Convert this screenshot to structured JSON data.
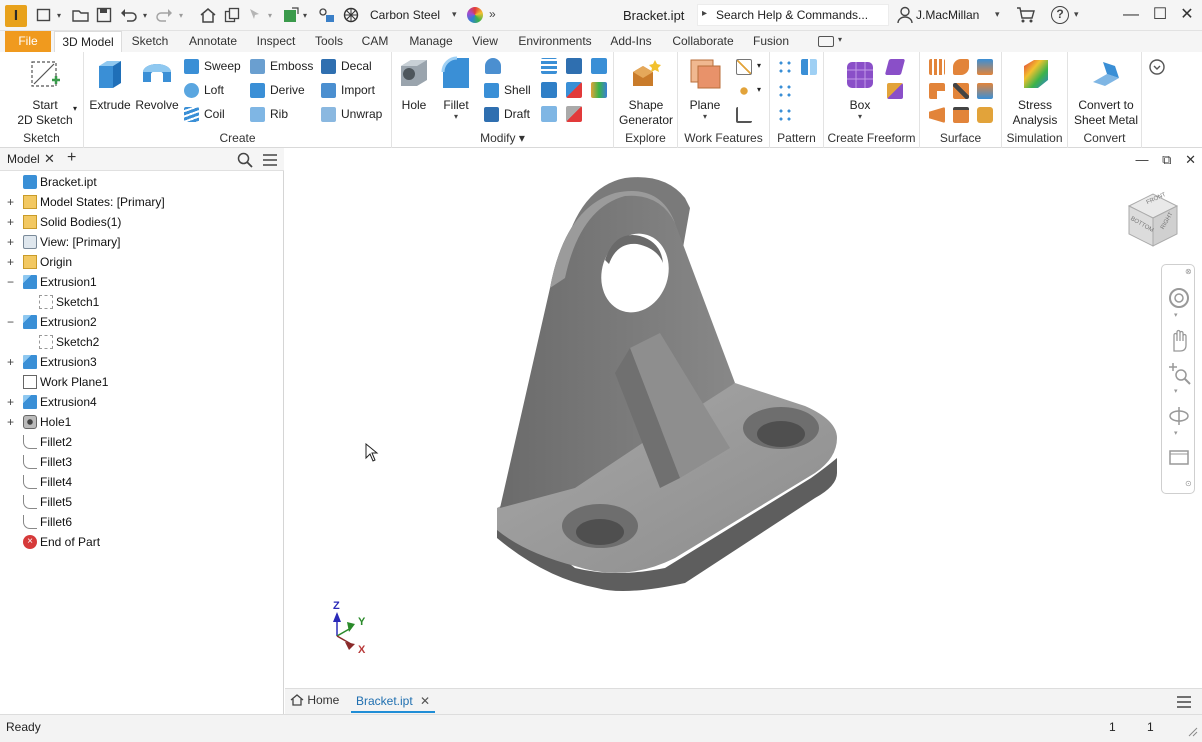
{
  "app": {
    "logo_letter": "I"
  },
  "titlebar": {
    "material": "Carbon Steel",
    "document_title": "Bracket.ipt",
    "search_placeholder": "Search Help & Commands...",
    "user": "J.MacMillan",
    "help_symbol": "?",
    "window_buttons": {
      "minimize": "—",
      "maximize": "☐",
      "close": "✕"
    }
  },
  "ribbon_tabs": [
    "File",
    "3D Model",
    "Sketch",
    "Annotate",
    "Inspect",
    "Tools",
    "CAM",
    "Manage",
    "View",
    "Environments",
    "Add-Ins",
    "Collaborate",
    "Fusion"
  ],
  "active_tab": "3D Model",
  "ribbon": {
    "sketch": {
      "label": "Sketch",
      "start_line1": "Start",
      "start_line2": "2D Sketch"
    },
    "create": {
      "label": "Create",
      "extrude": "Extrude",
      "revolve": "Revolve",
      "sweep": "Sweep",
      "loft": "Loft",
      "coil": "Coil",
      "emboss": "Emboss",
      "derive": "Derive",
      "rib": "Rib",
      "decal": "Decal",
      "import": "Import",
      "unwrap": "Unwrap"
    },
    "modify": {
      "label": "Modify",
      "hole": "Hole",
      "fillet": "Fillet",
      "shell": "Shell",
      "draft": "Draft"
    },
    "explore": {
      "label": "Explore",
      "line1": "Shape",
      "line2": "Generator"
    },
    "work_features": {
      "label": "Work Features",
      "plane": "Plane"
    },
    "pattern": {
      "label": "Pattern"
    },
    "freeform": {
      "label": "Create Freeform",
      "box": "Box"
    },
    "surface": {
      "label": "Surface"
    },
    "simulation": {
      "label": "Simulation",
      "line1": "Stress",
      "line2": "Analysis"
    },
    "convert": {
      "label": "Convert",
      "line1": "Convert to",
      "line2": "Sheet Metal"
    }
  },
  "browser": {
    "tab_label": "Model",
    "tree": [
      {
        "label": "Bracket.ipt",
        "icon": "part-icon",
        "expander": "",
        "indent": 0
      },
      {
        "label": "Model States: [Primary]",
        "icon": "folder-icon",
        "expander": "+",
        "indent": 0
      },
      {
        "label": "Solid Bodies(1)",
        "icon": "solid-bodies-icon",
        "expander": "+",
        "indent": 0
      },
      {
        "label": "View: [Primary]",
        "icon": "view-icon",
        "expander": "+",
        "indent": 0
      },
      {
        "label": "Origin",
        "icon": "origin-icon",
        "expander": "+",
        "indent": 0
      },
      {
        "label": "Extrusion1",
        "icon": "extrusion-icon",
        "expander": "−",
        "indent": 0
      },
      {
        "label": "Sketch1",
        "icon": "sketch-icon",
        "expander": "",
        "indent": 1
      },
      {
        "label": "Extrusion2",
        "icon": "extrusion-icon",
        "expander": "−",
        "indent": 0
      },
      {
        "label": "Sketch2",
        "icon": "sketch-icon",
        "expander": "",
        "indent": 1
      },
      {
        "label": "Extrusion3",
        "icon": "extrusion-icon",
        "expander": "+",
        "indent": 0
      },
      {
        "label": "Work Plane1",
        "icon": "work-plane-icon",
        "expander": "",
        "indent": 0
      },
      {
        "label": "Extrusion4",
        "icon": "extrusion-icon",
        "expander": "+",
        "indent": 0
      },
      {
        "label": "Hole1",
        "icon": "hole-icon",
        "expander": "+",
        "indent": 0
      },
      {
        "label": "Fillet2",
        "icon": "fillet-icon",
        "expander": "",
        "indent": 0
      },
      {
        "label": "Fillet3",
        "icon": "fillet-icon",
        "expander": "",
        "indent": 0
      },
      {
        "label": "Fillet4",
        "icon": "fillet-icon",
        "expander": "",
        "indent": 0
      },
      {
        "label": "Fillet5",
        "icon": "fillet-icon",
        "expander": "",
        "indent": 0
      },
      {
        "label": "Fillet6",
        "icon": "fillet-icon",
        "expander": "",
        "indent": 0
      },
      {
        "label": "End of Part",
        "icon": "end-of-part-icon",
        "expander": "",
        "indent": 0
      }
    ]
  },
  "viewcube": {
    "face_front": "FRONT",
    "face_right": "RIGHT",
    "face_bottom": "BOTTOM"
  },
  "triad": {
    "x": "X",
    "y": "Y",
    "z": "Z"
  },
  "document_tabs": {
    "home": "Home",
    "active": "Bracket.ipt"
  },
  "statusbar": {
    "status": "Ready",
    "count1": "1",
    "count2": "1"
  },
  "colors": {
    "accent": "#1f8dd6",
    "file_tab": "#f09a1e",
    "model_gray": "#7a7a7a"
  }
}
